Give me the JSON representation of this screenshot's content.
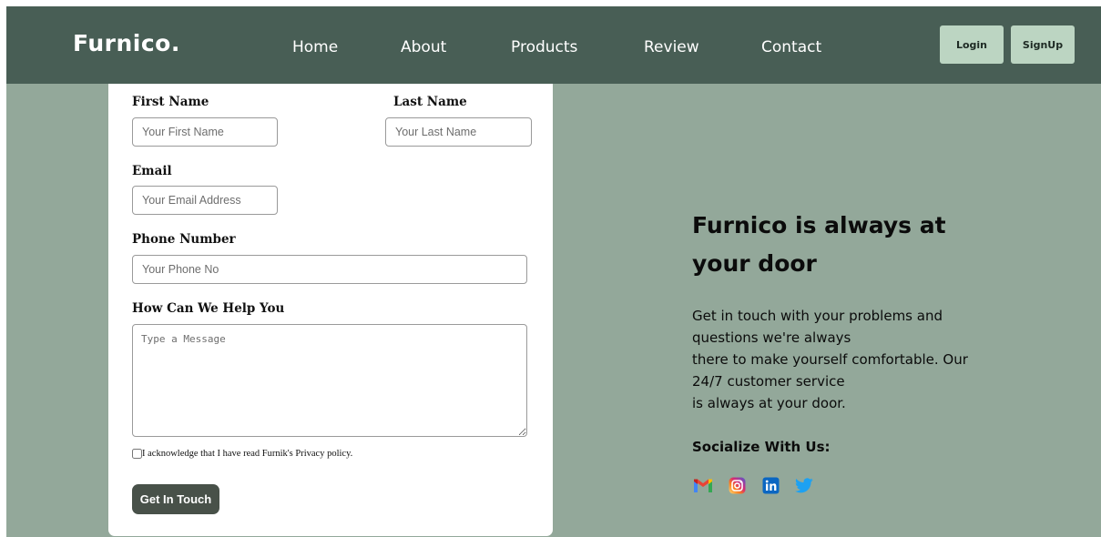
{
  "brand": {
    "logo": "Furnico."
  },
  "nav": {
    "links": [
      "Home",
      "About",
      "Products",
      "Review",
      "Contact"
    ],
    "login_label": "Login",
    "signup_label": "SignUp"
  },
  "form": {
    "first_name": {
      "label": "First Name",
      "placeholder": "Your First Name"
    },
    "last_name": {
      "label": "Last Name",
      "placeholder": "Your Last Name"
    },
    "email": {
      "label": "Email",
      "placeholder": "Your Email Address"
    },
    "phone": {
      "label": "Phone Number",
      "placeholder": "Your Phone No"
    },
    "message": {
      "label": "How Can We Help You",
      "placeholder": "Type a Message"
    },
    "privacy_text": "I acknowledge that I have read Furnik's Privacy policy.",
    "submit_label": "Get In Touch"
  },
  "info": {
    "headline": "Furnico is always at your door",
    "paragraph_lines": [
      "Get in touch with your problems and",
      "questions we're always",
      "there to make yourself comfortable. Our",
      "24/7 customer service",
      "is always at your door."
    ],
    "social_title": "Socialize With Us:",
    "social_icons": [
      "gmail-icon",
      "instagram-icon",
      "linkedin-icon",
      "twitter-icon"
    ]
  },
  "colors": {
    "navbar": "#485e55",
    "background": "#93a89a",
    "nav_button": "#bcd5c2",
    "submit_button": "#485149"
  }
}
